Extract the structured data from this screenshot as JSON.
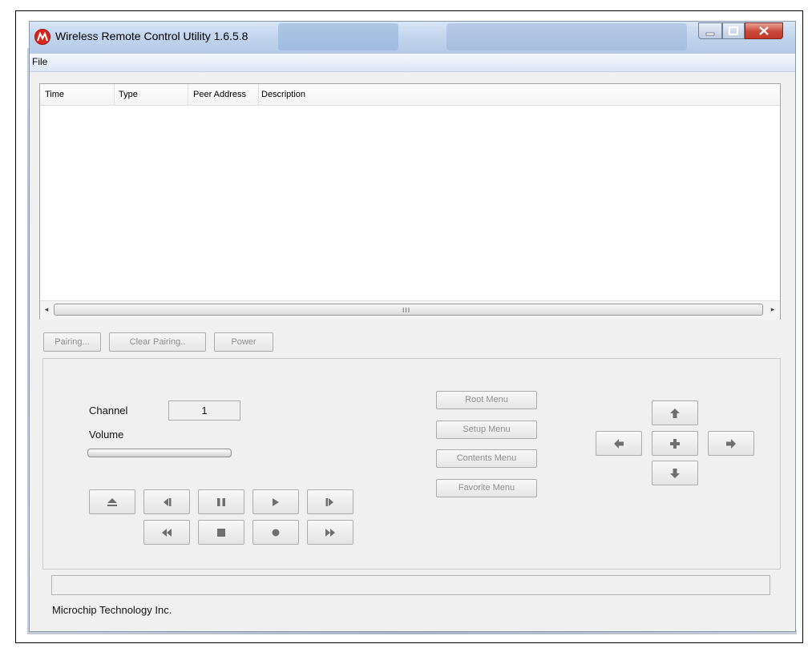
{
  "window": {
    "title": "Wireless Remote Control Utility 1.6.5.8"
  },
  "menubar": {
    "file": "File"
  },
  "log_table": {
    "columns": [
      "Time",
      "Type",
      "Peer Address",
      "Description"
    ],
    "scroll_grip": "III"
  },
  "actions": {
    "pairing": "Pairing...",
    "clear_pairing": "Clear Pairing..",
    "power": "Power"
  },
  "controls": {
    "channel_label": "Channel",
    "channel_value": "1",
    "volume_label": "Volume",
    "volume_level": 0,
    "media_buttons_row1": [
      "eject-icon",
      "skip-back-icon",
      "pause-icon",
      "play-icon",
      "skip-forward-icon"
    ],
    "media_buttons_row2": [
      "rewind-icon",
      "stop-icon",
      "record-icon",
      "fast-forward-icon"
    ],
    "menu_buttons": [
      "Root Menu",
      "Setup Menu",
      "Contents Menu",
      "Favorite Menu"
    ],
    "nav_buttons": [
      "arrow-up-icon",
      "arrow-left-icon",
      "select-plus-icon",
      "arrow-right-icon",
      "arrow-down-icon"
    ]
  },
  "status": {
    "text": ""
  },
  "footer": {
    "company": "Microchip Technology Inc."
  },
  "colors": {
    "titlebar": "#c3d6ee",
    "window_bg": "#f0f0f0",
    "close_button": "#c9473a",
    "disabled_text": "#8e8e8e"
  }
}
